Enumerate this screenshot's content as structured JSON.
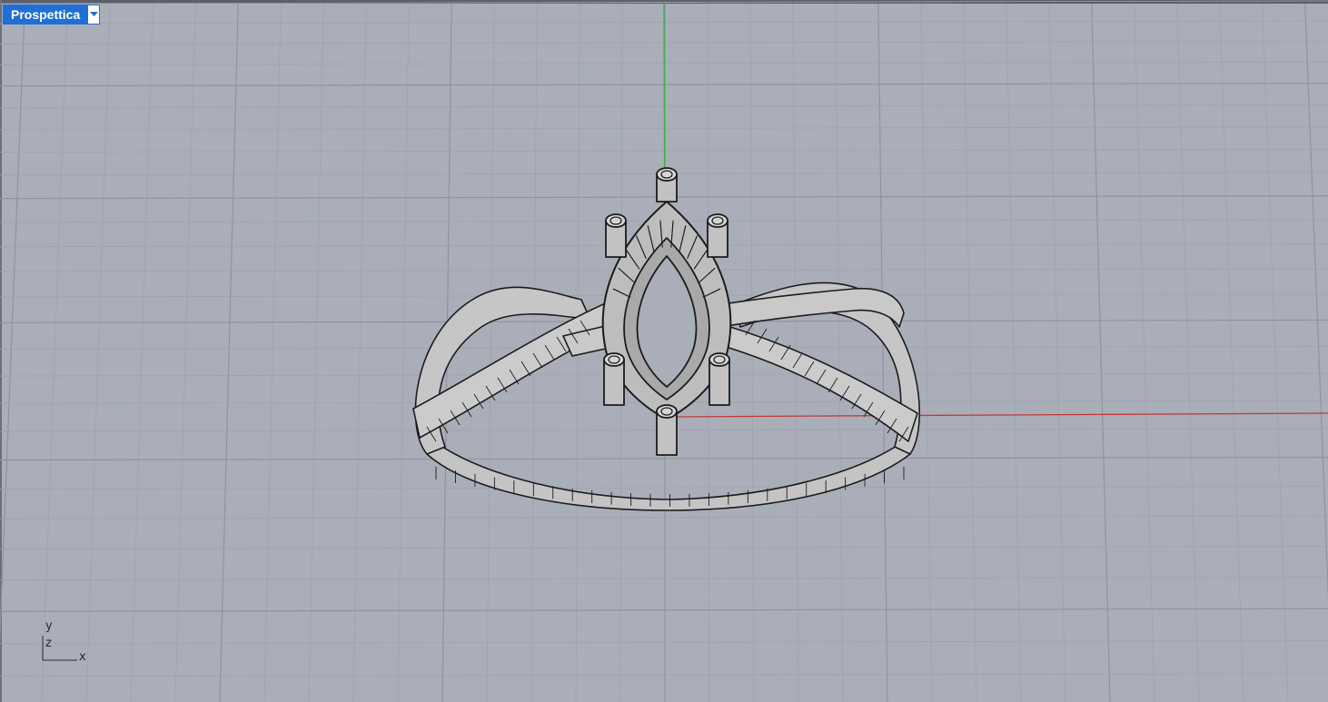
{
  "viewport": {
    "title": "Prospettica",
    "menu_icon": "dropdown-arrow-icon"
  },
  "axis_gizmo": {
    "y": "y",
    "z": "z",
    "x": "x"
  },
  "colors": {
    "background": "#a9aeb9",
    "grid_minor": "#9ea3ae",
    "grid_major": "#8f949f",
    "axis_x": "#c0393b",
    "axis_y": "#3cb043",
    "model_fill": "#c2c2c2",
    "model_edge": "#1c1c1c",
    "tab_accent": "#1f6fd6"
  },
  "scene": {
    "object": "ring-with-marquise-setting",
    "display_mode": "wireframe-shaded"
  }
}
